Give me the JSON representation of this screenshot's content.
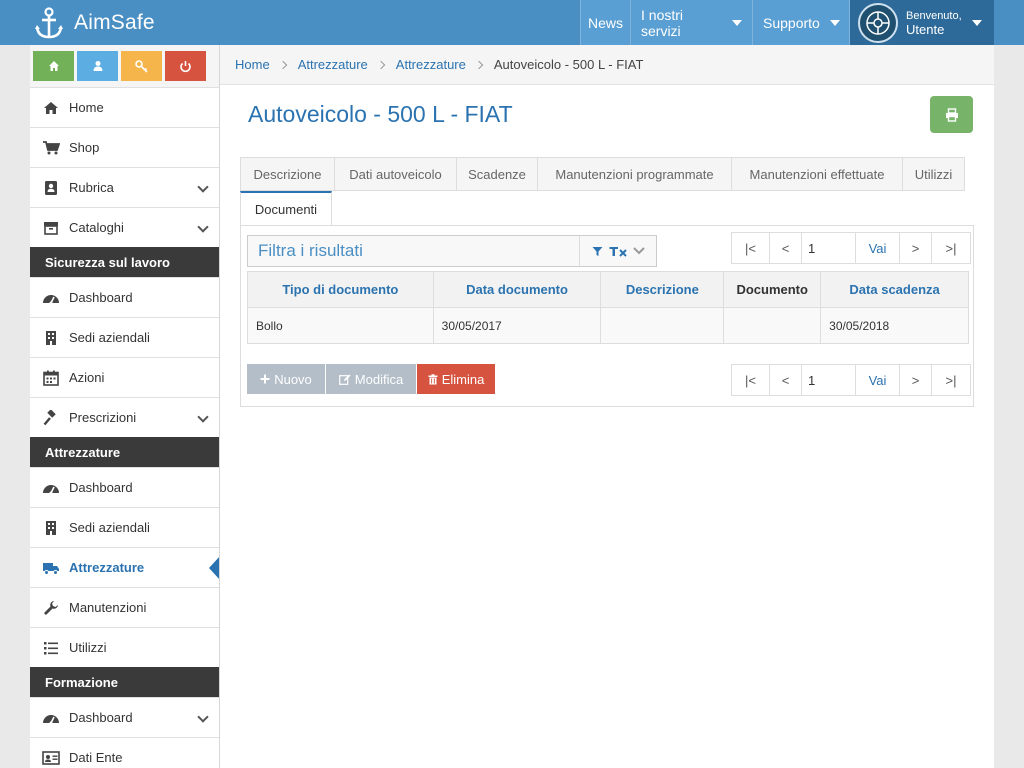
{
  "app": {
    "title": "AimSafe"
  },
  "nav": {
    "news": "News",
    "servizi": "I nostri servizi",
    "supporto": "Supporto",
    "user_greeting": "Benvenuto,",
    "user_name": "Utente"
  },
  "sidebar": {
    "top_items": [
      {
        "label": "Home",
        "icon": "home-icon"
      },
      {
        "label": "Shop",
        "icon": "cart-icon"
      },
      {
        "label": "Rubrica",
        "icon": "address-book-icon"
      },
      {
        "label": "Cataloghi",
        "icon": "catalog-icon"
      }
    ],
    "sections": [
      {
        "title": "Sicurezza sul lavoro",
        "items": [
          "Dashboard",
          "Sedi aziendali",
          "Azioni",
          "Prescrizioni"
        ]
      },
      {
        "title": "Attrezzature",
        "items": [
          "Dashboard",
          "Sedi aziendali",
          "Attrezzature",
          "Manutenzioni",
          "Utilizzi"
        ]
      },
      {
        "title": "Formazione",
        "items": [
          "Dashboard",
          "Dati Ente"
        ]
      }
    ]
  },
  "breadcrumb": {
    "items": [
      "Home",
      "Attrezzature",
      "Attrezzature"
    ],
    "current": "Autoveicolo - 500 L - FIAT"
  },
  "page": {
    "title": "Autoveicolo - 500 L - FIAT"
  },
  "tabs": {
    "row1": [
      "Descrizione",
      "Dati autoveicolo",
      "Scadenze",
      "Manutenzioni programmate",
      "Manutenzioni effettuate",
      "Utilizzi"
    ],
    "active": "Documenti"
  },
  "filter": {
    "placeholder": "Filtra i risultati"
  },
  "pager": {
    "first": "|<",
    "prev": "<",
    "page": "1",
    "go": "Vai",
    "next": ">",
    "last": ">|"
  },
  "table": {
    "headers": [
      "Tipo di documento",
      "Data documento",
      "Descrizione",
      "Documento",
      "Data scadenza"
    ],
    "rows": [
      [
        "Bollo",
        "30/05/2017",
        "",
        "",
        "30/05/2018"
      ]
    ]
  },
  "actions": {
    "nuovo": "Nuovo",
    "modifica": "Modifica",
    "elimina": "Elimina"
  },
  "colors": {
    "navbar": "#4a8fc4",
    "accent": "#2b73b0",
    "danger": "#d6533f",
    "success": "#77b46a"
  }
}
